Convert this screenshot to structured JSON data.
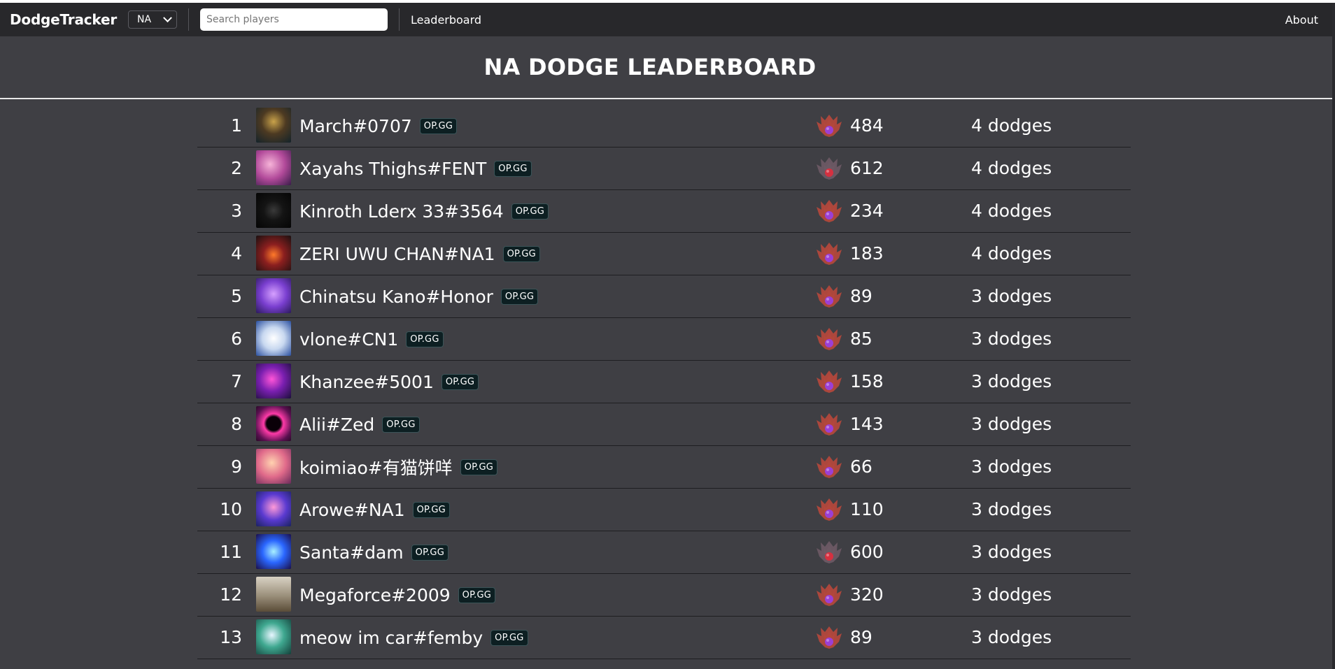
{
  "navbar": {
    "brand": "DodgeTracker",
    "region_selected": "NA",
    "search_placeholder": "Search players",
    "leaderboard_link": "Leaderboard",
    "about_link": "About"
  },
  "page": {
    "title": "NA DODGE LEADERBOARD"
  },
  "colors": {
    "background": "#3f3f44",
    "navbar": "#28282b",
    "opgg_badge": "#0d1f22",
    "emblem_wing_red": "#b8483c",
    "emblem_wing_grey": "#6e5a66",
    "emblem_gem_purple": "#9b3fd6",
    "emblem_gem_red": "#d63040"
  },
  "opgg_label": "OP.GG",
  "rows": [
    {
      "rank": "1",
      "name": "March#0707",
      "lp": "484",
      "dodges": "4 dodges",
      "emblem": "master",
      "avatar_icon": "champion-portrait-icon"
    },
    {
      "rank": "2",
      "name": "Xayahs Thighs#FENT",
      "lp": "612",
      "dodges": "4 dodges",
      "emblem": "grandmaster",
      "avatar_icon": "champion-portrait-icon"
    },
    {
      "rank": "3",
      "name": "Kinroth Lderx 33#3564",
      "lp": "234",
      "dodges": "4 dodges",
      "emblem": "master",
      "avatar_icon": "helmet-portrait-icon"
    },
    {
      "rank": "4",
      "name": "ZERI UWU CHAN#NA1",
      "lp": "183",
      "dodges": "4 dodges",
      "emblem": "master",
      "avatar_icon": "flame-portrait-icon"
    },
    {
      "rank": "5",
      "name": "Chinatsu Kano#Honor",
      "lp": "89",
      "dodges": "3 dodges",
      "emblem": "master",
      "avatar_icon": "champion-portrait-icon"
    },
    {
      "rank": "6",
      "name": "vlone#CN1",
      "lp": "85",
      "dodges": "3 dodges",
      "emblem": "master",
      "avatar_icon": "bear-portrait-icon"
    },
    {
      "rank": "7",
      "name": "Khanzee#5001",
      "lp": "158",
      "dodges": "3 dodges",
      "emblem": "master",
      "avatar_icon": "champion-portrait-icon"
    },
    {
      "rank": "8",
      "name": "Alii#Zed",
      "lp": "143",
      "dodges": "3 dodges",
      "emblem": "master",
      "avatar_icon": "vortex-portrait-icon"
    },
    {
      "rank": "9",
      "name": "koimiao#有猫饼咩",
      "lp": "66",
      "dodges": "3 dodges",
      "emblem": "master",
      "avatar_icon": "champion-portrait-icon"
    },
    {
      "rank": "10",
      "name": "Arowe#NA1",
      "lp": "110",
      "dodges": "3 dodges",
      "emblem": "master",
      "avatar_icon": "champion-portrait-icon"
    },
    {
      "rank": "11",
      "name": "Santa#dam",
      "lp": "600",
      "dodges": "3 dodges",
      "emblem": "grandmaster",
      "avatar_icon": "snowflake-portrait-icon"
    },
    {
      "rank": "12",
      "name": "Megaforce#2009",
      "lp": "320",
      "dodges": "3 dodges",
      "emblem": "master",
      "avatar_icon": "trophy-portrait-icon"
    },
    {
      "rank": "13",
      "name": "meow im car#femby",
      "lp": "89",
      "dodges": "3 dodges",
      "emblem": "master",
      "avatar_icon": "champion-portrait-icon"
    }
  ]
}
